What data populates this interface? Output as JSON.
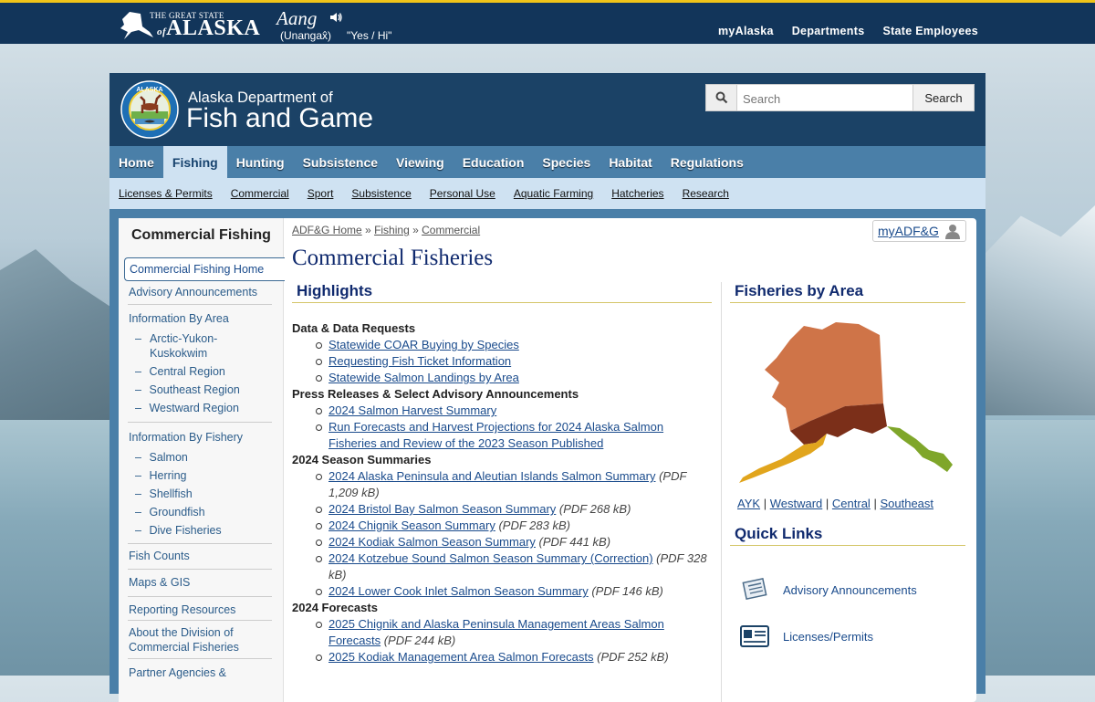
{
  "topbar": {
    "state_small": "THE GREAT STATE",
    "state_of": "of",
    "state_big": "ALASKA",
    "word": "Aang",
    "word_lang": "(Unangax̂)",
    "word_translation": "\"Yes / Hi\"",
    "links": [
      "myAlaska",
      "Departments",
      "State Employees"
    ]
  },
  "header": {
    "dept_line1": "Alaska Department of",
    "dept_line2": "Fish and Game",
    "seal_top": "ALASKA",
    "search_placeholder": "Search",
    "search_button": "Search"
  },
  "nav": {
    "items": [
      "Home",
      "Fishing",
      "Hunting",
      "Subsistence",
      "Viewing",
      "Education",
      "Species",
      "Habitat",
      "Regulations"
    ],
    "active": "Fishing"
  },
  "subnav": [
    "Licenses & Permits",
    "Commercial",
    "Sport",
    "Subsistence",
    "Personal Use",
    "Aquatic Farming",
    "Hatcheries",
    "Research"
  ],
  "sidebar": {
    "title": "Commercial Fishing",
    "active": "Commercial Fishing Home",
    "advisory": "Advisory Announcements",
    "by_area": "Information By Area",
    "areas": [
      "Arctic-Yukon-Kuskokwim",
      "Central Region",
      "Southeast Region",
      "Westward Region"
    ],
    "by_fishery": "Information By Fishery",
    "fisheries": [
      "Salmon",
      "Herring",
      "Shellfish",
      "Groundfish",
      "Dive Fisheries"
    ],
    "fish_counts": "Fish Counts",
    "maps": "Maps & GIS",
    "reporting": "Reporting Resources",
    "about": "About the Division of Commercial Fisheries",
    "partner": "Partner Agencies &"
  },
  "breadcrumb": [
    "ADF&G Home",
    "Fishing",
    "Commercial"
  ],
  "breadcrumb_sep": "»",
  "myadfg": "myADF&G",
  "page_title": "Commercial Fisheries",
  "highlights": {
    "heading": "Highlights",
    "sections": [
      {
        "title": "Data & Data Requests",
        "items": [
          {
            "text": "Statewide COAR Buying by Species",
            "size": ""
          },
          {
            "text": "Requesting Fish Ticket Information",
            "size": ""
          },
          {
            "text": "Statewide Salmon Landings by Area",
            "size": ""
          }
        ]
      },
      {
        "title": "Press Releases & Select Advisory Announcements",
        "items": [
          {
            "text": "2024 Salmon Harvest Summary",
            "size": ""
          },
          {
            "text": "Run Forecasts and Harvest Projections for 2024 Alaska Salmon Fisheries and Review of the 2023 Season Published",
            "size": ""
          }
        ]
      },
      {
        "title": "2024 Season Summaries",
        "items": [
          {
            "text": "2024 Alaska Peninsula and Aleutian Islands Salmon Summary",
            "size": "(PDF 1,209 kB)"
          },
          {
            "text": "2024 Bristol Bay Salmon Season Summary",
            "size": "(PDF 268 kB)"
          },
          {
            "text": "2024 Chignik Season Summary",
            "size": "(PDF 283 kB)"
          },
          {
            "text": "2024 Kodiak Salmon Season Summary",
            "size": "(PDF 441 kB)"
          },
          {
            "text": "2024 Kotzebue Sound Salmon Season Summary (Correction)",
            "size": "(PDF 328 kB)"
          },
          {
            "text": "2024 Lower Cook Inlet Salmon Season Summary",
            "size": "(PDF 146 kB)"
          }
        ]
      },
      {
        "title": "2024 Forecasts",
        "items": [
          {
            "text": "2025 Chignik and Alaska Peninsula Management Areas Salmon Forecasts",
            "size": "(PDF 244 kB)"
          },
          {
            "text": "2025 Kodiak Management Area Salmon Forecasts",
            "size": "(PDF 252 kB)"
          }
        ]
      }
    ]
  },
  "fisheries_by_area": {
    "heading": "Fisheries by Area",
    "regions": [
      "AYK",
      "Westward",
      "Central",
      "Southeast"
    ],
    "sep": "|",
    "colors": {
      "ayk": "#cf7448",
      "central": "#7b2f19",
      "westward": "#e1a51d",
      "southeast": "#7fa62a"
    }
  },
  "quick_links": {
    "heading": "Quick Links",
    "items": [
      {
        "label": "Advisory Announcements",
        "icon": "newspaper-icon"
      },
      {
        "label": "Licenses/Permits",
        "icon": "license-card-icon"
      }
    ]
  }
}
